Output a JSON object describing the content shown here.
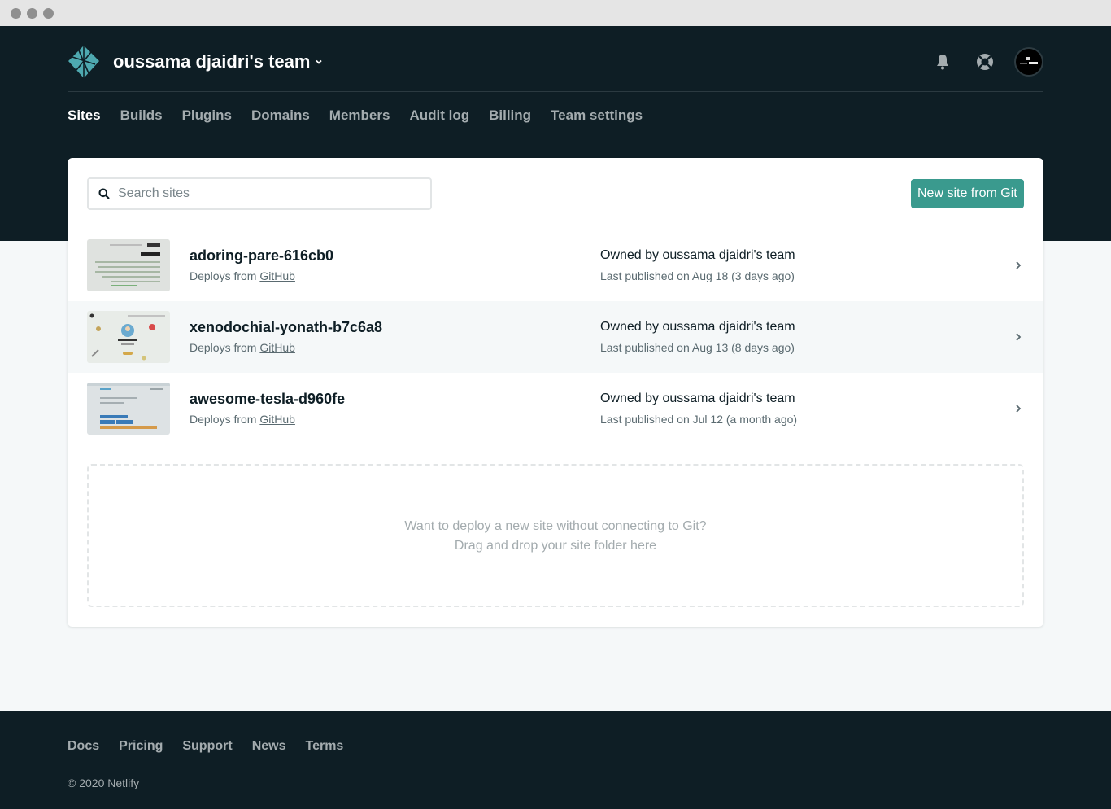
{
  "team": {
    "name": "oussama djaidri's team"
  },
  "nav": {
    "tabs": [
      {
        "label": "Sites",
        "active": true
      },
      {
        "label": "Builds"
      },
      {
        "label": "Plugins"
      },
      {
        "label": "Domains"
      },
      {
        "label": "Members"
      },
      {
        "label": "Audit log"
      },
      {
        "label": "Billing"
      },
      {
        "label": "Team settings"
      }
    ]
  },
  "search": {
    "placeholder": "Search sites",
    "value": ""
  },
  "actions": {
    "new_site_label": "New site from Git"
  },
  "sites": [
    {
      "name": "adoring-pare-616cb0",
      "deploys_prefix": "Deploys from",
      "deploys_source": "GitHub",
      "owner": "Owned by oussama djaidri's team",
      "published": "Last published on Aug 18 (3 days ago)"
    },
    {
      "name": "xenodochial-yonath-b7c6a8",
      "deploys_prefix": "Deploys from",
      "deploys_source": "GitHub",
      "owner": "Owned by oussama djaidri's team",
      "published": "Last published on Aug 13 (8 days ago)"
    },
    {
      "name": "awesome-tesla-d960fe",
      "deploys_prefix": "Deploys from",
      "deploys_source": "GitHub",
      "owner": "Owned by oussama djaidri's team",
      "published": "Last published on Jul 12 (a month ago)"
    }
  ],
  "dropzone": {
    "line1": "Want to deploy a new site without connecting to Git?",
    "line2": "Drag and drop your site folder here"
  },
  "footer": {
    "links": [
      "Docs",
      "Pricing",
      "Support",
      "News",
      "Terms"
    ],
    "copyright": "© 2020 Netlify"
  },
  "colors": {
    "header_bg": "#0e1e25",
    "accent": "#3a9a8e",
    "logo": "#4ea9b0"
  },
  "icons": {
    "logo": "netlify-logo-icon",
    "notifications": "bell-icon",
    "support": "lifebuoy-icon",
    "search": "search-icon",
    "row": "chevron-right-icon"
  }
}
